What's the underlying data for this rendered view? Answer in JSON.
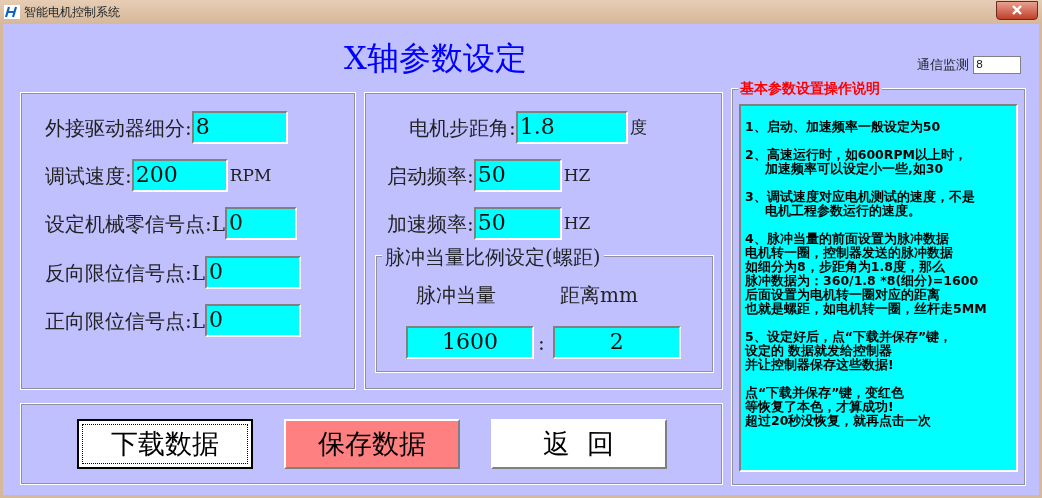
{
  "window": {
    "title": "智能电机控制系统"
  },
  "heading": "X轴参数设定",
  "monitor": {
    "label": "通信监测",
    "value": "8"
  },
  "left_group": {
    "fields": [
      {
        "label": "外接驱动器细分:",
        "value": "8"
      },
      {
        "label": "调试速度:",
        "value": "200",
        "unit": "RPM"
      },
      {
        "label": "设定机械零信号点:L",
        "value": "0"
      },
      {
        "label": "反向限位信号点:L",
        "value": "0"
      },
      {
        "label": "正向限位信号点:L",
        "value": "0"
      }
    ]
  },
  "right_group": {
    "fields": [
      {
        "label": "电机步距角:",
        "value": "1.8",
        "unit": "度"
      },
      {
        "label": "启动频率:",
        "value": "50",
        "unit": "HZ"
      },
      {
        "label": "加速频率:",
        "value": "50",
        "unit": "HZ"
      }
    ],
    "pulse_group": {
      "legend": "脉冲当量比例设定(螺距)",
      "pulse_label": "脉冲当量",
      "distance_label": "距离mm",
      "pulse_value": "1600",
      "separator": ":",
      "distance_value": "2"
    }
  },
  "buttons": [
    {
      "label": "下载数据",
      "color": "#ffffff",
      "focused": true
    },
    {
      "label": "保存数据",
      "color": "#ff8080",
      "focused": false
    },
    {
      "label": "返  回",
      "color": "#ffffff",
      "focused": false
    }
  ],
  "help": {
    "legend": "基本参数设置操作说明",
    "paragraphs": [
      {
        "lines": [
          "1、启动、加速频率一般设定为50"
        ]
      },
      {
        "indent": true,
        "lines": [
          "2、高速运行时，如600RPM以上时，",
          "加速频率可以设定小一些,如30"
        ]
      },
      {
        "indent": true,
        "lines": [
          "3、调试速度对应电机测试的速度，不是",
          "电机工程参数运行的速度。"
        ]
      },
      {
        "indent": false,
        "lines": [
          "4、脉冲当量的前面设置为脉冲数据",
          "电机转一圈，控制器发送的脉冲数据",
          "如细分为8，步距角为1.8度，那么",
          "脉冲数据为：360/1.8 *8(细分)=1600",
          "后面设置为电机转一圈对应的距离",
          "也就是螺距，如电机转一圈，丝杆走5MM"
        ]
      },
      {
        "indent": false,
        "lines": [
          "5、设定好后，点“下载并保存”键，",
          "设定的 数据就发给控制器",
          "并让控制器保存这些数据!"
        ]
      },
      {
        "indent": false,
        "lines": [
          "点“下载并保存”键，变红色",
          "等恢复了本色，才算成功!",
          "超过20秒没恢复，就再点击一次"
        ]
      }
    ]
  }
}
